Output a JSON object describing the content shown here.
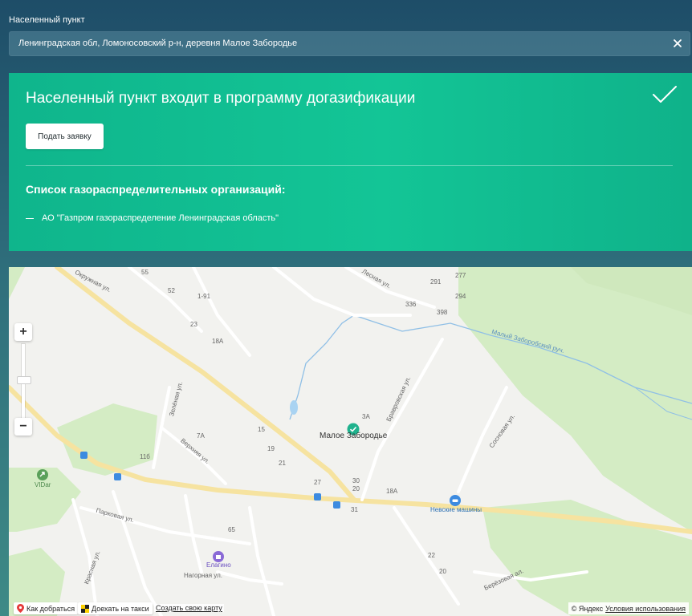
{
  "search": {
    "label": "Населенный пункт",
    "value": "Ленинградская обл, Ломоносовский р-н, деревня Малое Забородье"
  },
  "result": {
    "title": "Населенный пункт входит в программу догазификации",
    "apply_button": "Подать заявку",
    "orgs_heading": "Список газораспределительных организаций:",
    "orgs": [
      "АО \"Газпром газораспределение Ленинградская область\""
    ],
    "accent_color": "#13c596"
  },
  "map": {
    "zoom_in": "+",
    "zoom_out": "−",
    "place_name": "Малое Забородье",
    "streets": [
      "Окружная ул.",
      "Лесная ул.",
      "Зелёная ул.",
      "Бравровская ул.",
      "Верхняя ул.",
      "Сосновая ул.",
      "Парковая ул.",
      "Красная ул.",
      "Нагорная ул.",
      "Берёзовая ал.",
      "Малый Заборобский руч."
    ],
    "pois": [
      "VIDar",
      "Невские машины",
      "Елагино"
    ],
    "house_numbers": [
      "55",
      "52",
      "1-91",
      "23",
      "18А",
      "291",
      "294",
      "277",
      "336",
      "398",
      "3А",
      "15",
      "19",
      "21",
      "27",
      "30",
      "31",
      "20",
      "18А",
      "11б",
      "7А",
      "65",
      "22",
      "20"
    ],
    "footer": {
      "route_btn": "Как добраться",
      "taxi_btn": "Доехать на такси",
      "create_map": "Создать свою карту",
      "copyright": "© Яндекс",
      "terms": "Условия использования"
    }
  }
}
